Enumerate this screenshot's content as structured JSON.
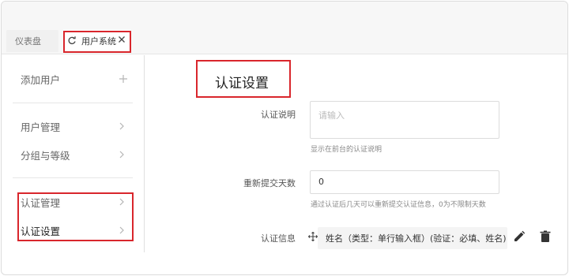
{
  "tabs": {
    "dashboard_label": "仪表盘",
    "users_label": "用户系统"
  },
  "sidebar": {
    "add_user": "添加用户",
    "user_management": "用户管理",
    "group_level": "分组与等级",
    "auth_management": "认证管理",
    "auth_settings": "认证设置"
  },
  "main": {
    "title": "认证设置",
    "description_label": "认证说明",
    "description_placeholder": "请输入",
    "description_help": "显示在前台的认证说明",
    "resubmit_label": "重新提交天数",
    "resubmit_value": "0",
    "resubmit_help": "通过认证后几天可以重新提交认证信息，0为不限制天数",
    "auth_info_label": "认证信息",
    "auth_info_item": "姓名（类型：单行输入框）(验证：必填、姓名)"
  },
  "colors": {
    "highlight_red": "#d9262c",
    "icon_dark": "#333333",
    "muted_text": "#888888"
  }
}
